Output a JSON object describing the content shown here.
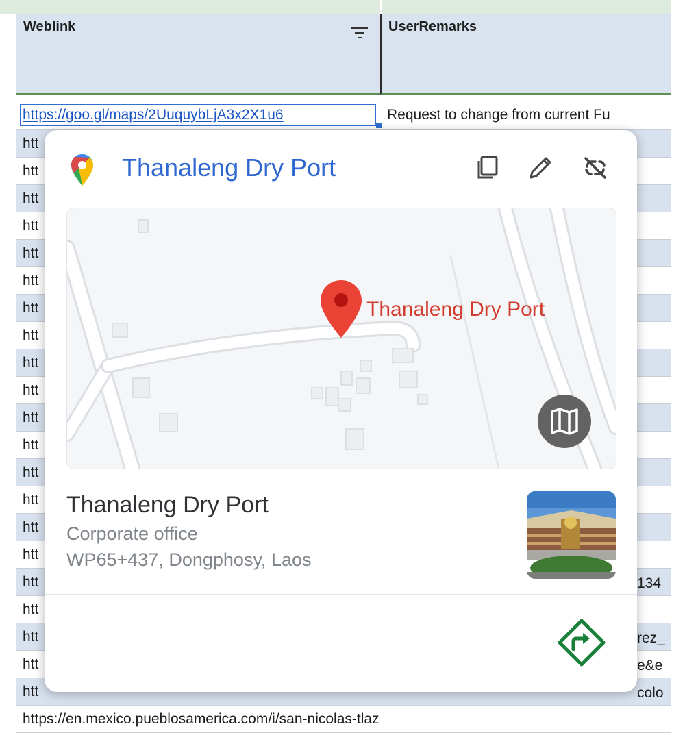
{
  "sheet": {
    "headers": {
      "weblink": "Weblink",
      "user_remarks": "UserRemarks"
    },
    "rows": [
      {
        "weblink": "https://goo.gl/maps/2UuquybLjA3x2X1u6",
        "remarks": "Request to change from current Fu"
      },
      {
        "weblink": "htt",
        "remarks": ""
      },
      {
        "weblink": "htt",
        "remarks": ""
      },
      {
        "weblink": "htt",
        "remarks": ""
      },
      {
        "weblink": "htt",
        "remarks": ""
      },
      {
        "weblink": "htt",
        "remarks": ""
      },
      {
        "weblink": "htt",
        "remarks": ""
      },
      {
        "weblink": "htt",
        "remarks": ""
      },
      {
        "weblink": "htt",
        "remarks": ""
      },
      {
        "weblink": "htt",
        "remarks": ""
      },
      {
        "weblink": "htt",
        "remarks": ""
      },
      {
        "weblink": "htt",
        "remarks": ""
      },
      {
        "weblink": "htt",
        "remarks": ""
      },
      {
        "weblink": "htt",
        "remarks": ""
      },
      {
        "weblink": "htt",
        "remarks": ""
      },
      {
        "weblink": "htt",
        "remarks": ""
      },
      {
        "weblink": "htt",
        "remarks": ""
      },
      {
        "weblink": "htt",
        "remarks": "134"
      },
      {
        "weblink": "htt",
        "remarks": ""
      },
      {
        "weblink": "htt",
        "remarks": "rez_"
      },
      {
        "weblink": "htt",
        "remarks": "e&e"
      },
      {
        "weblink": "htt",
        "remarks": "colo"
      },
      {
        "weblink": "https://en.mexico.pueblosamerica.com/i/san-nicolas-tlazala/",
        "remarks": ""
      }
    ]
  },
  "popup": {
    "title": "Thanaleng Dry Port",
    "map_pin_label": "Thanaleng Dry Port",
    "place_name": "Thanaleng Dry Port",
    "place_category": "Corporate office",
    "place_address": "WP65+437, Dongphosy, Laos",
    "icons": {
      "app": "google-maps-icon",
      "copy": "copy-icon",
      "edit": "edit-pencil-icon",
      "unlink": "unlink-icon",
      "map_layer": "map-layer-icon",
      "directions": "directions-icon"
    },
    "colors": {
      "title": "#2f68d0",
      "pin": "#ea4335",
      "directions": "#188038"
    }
  }
}
